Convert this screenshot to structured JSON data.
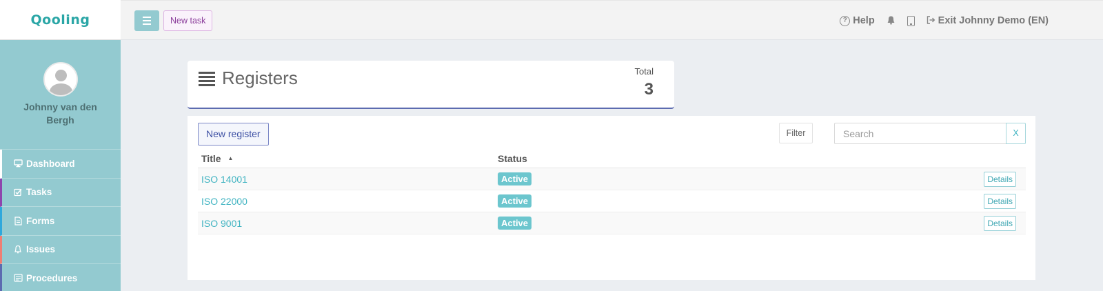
{
  "brand": {
    "logo": "Qooling"
  },
  "user": {
    "name": "Johnny van den Bergh"
  },
  "sidebar": {
    "items": [
      {
        "label": "Dashboard",
        "icon": "monitor-icon",
        "accent": "#ffffff"
      },
      {
        "label": "Tasks",
        "icon": "check-square-icon",
        "accent": "#8e44ad"
      },
      {
        "label": "Forms",
        "icon": "document-icon",
        "accent": "#2ea8dc"
      },
      {
        "label": "Issues",
        "icon": "bell-icon",
        "accent": "#ee7e74"
      },
      {
        "label": "Procedures",
        "icon": "procedures-icon",
        "accent": "#5c6bb0"
      }
    ]
  },
  "topbar": {
    "new_task_label": "New task",
    "help_label": "Help",
    "exit_label": "Exit Johnny Demo (EN)"
  },
  "page": {
    "title": "Registers",
    "total_label": "Total",
    "total_value": "3"
  },
  "toolbar": {
    "new_register_label": "New register",
    "filter_label": "Filter",
    "search_placeholder": "Search",
    "clear_label": "X"
  },
  "table": {
    "columns": {
      "title": "Title",
      "status": "Status"
    },
    "rows": [
      {
        "title": "ISO 14001",
        "status": "Active",
        "action": "Details"
      },
      {
        "title": "ISO 22000",
        "status": "Active",
        "action": "Details"
      },
      {
        "title": "ISO 9001",
        "status": "Active",
        "action": "Details"
      }
    ]
  },
  "colors": {
    "sidebar_bg": "#93cad0",
    "link": "#3fb3c1",
    "badge": "#6cc6ce",
    "primary": "#5c6bb0"
  }
}
